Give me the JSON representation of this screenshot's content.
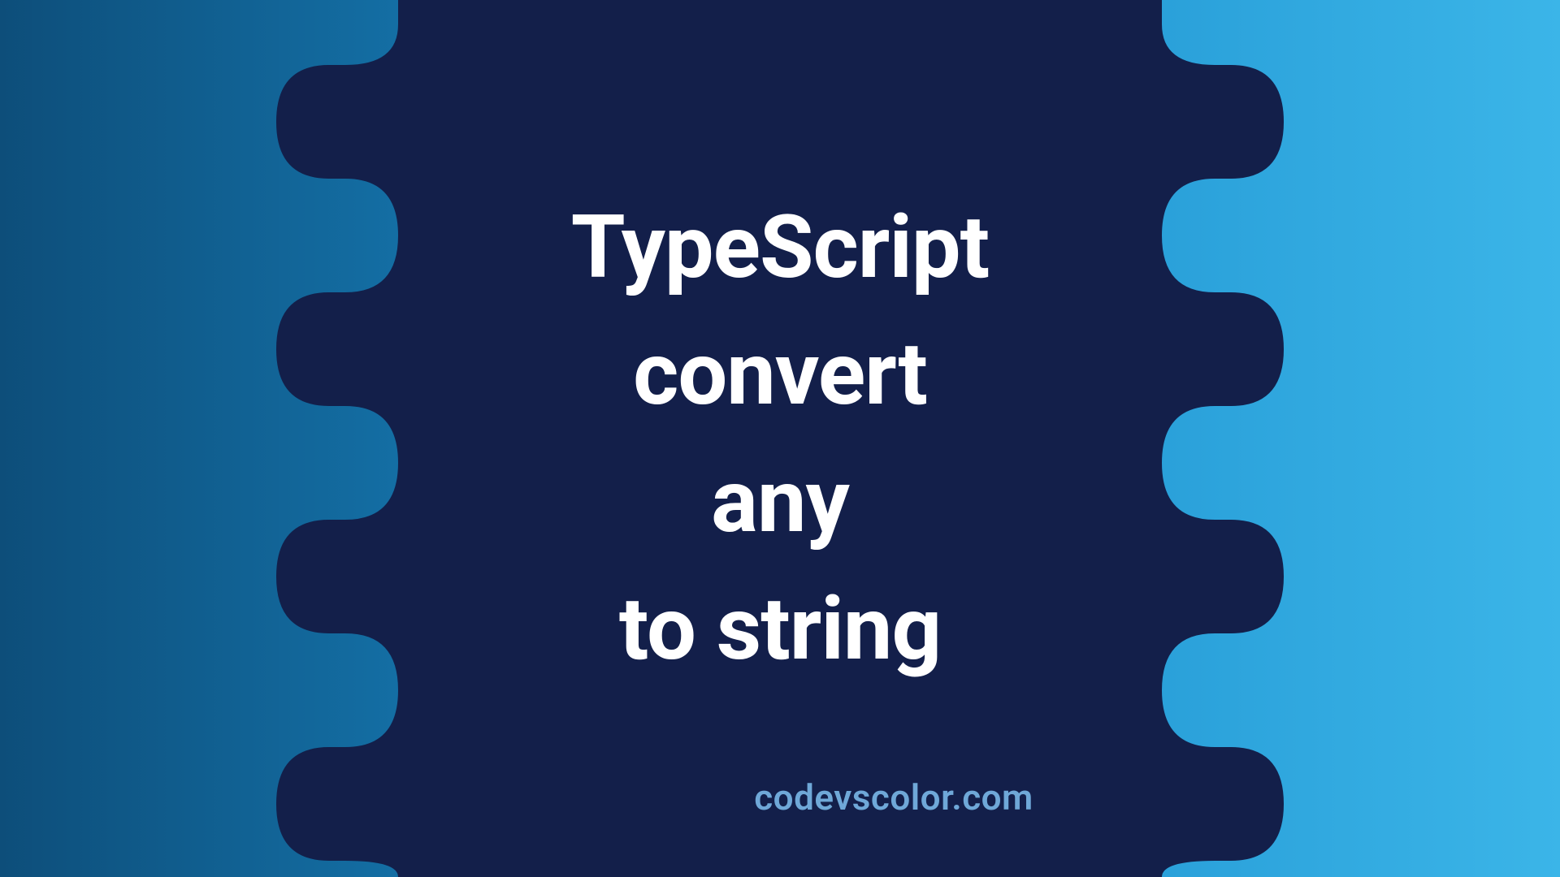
{
  "title": {
    "line1": "TypeScript",
    "line2": "convert",
    "line3": "any",
    "line4": "to string"
  },
  "footer": "codevscolor.com",
  "colors": {
    "blob": "#131f4a",
    "text": "#ffffff",
    "footer": "#6fa8d8",
    "gradient_start": "#0d4e7a",
    "gradient_end": "#3bb5e8"
  }
}
